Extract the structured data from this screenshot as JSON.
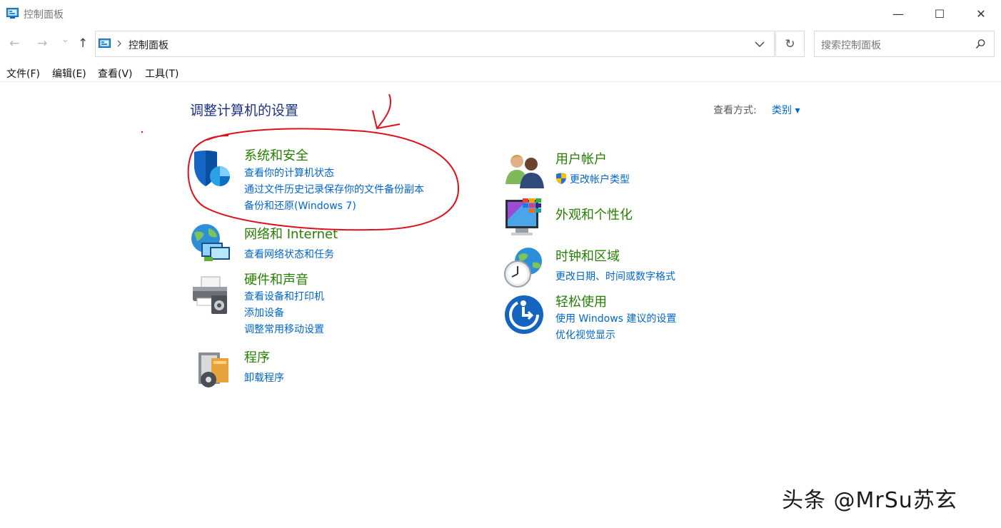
{
  "window": {
    "title": "控制面板",
    "minimize_label": "—",
    "maximize_label": "☐",
    "close_label": "✕"
  },
  "nav": {
    "back_label": "←",
    "forward_label": "→",
    "recent_label": "⌄",
    "up_label": "↑",
    "breadcrumb": "控制面板",
    "refresh_label": "↻",
    "search_placeholder": "搜索控制面板"
  },
  "menu": [
    "文件(F)",
    "编辑(E)",
    "查看(V)",
    "工具(T)"
  ],
  "main": {
    "heading": "调整计算机的设置",
    "view_by_label": "查看方式:",
    "view_by_value": "类别 ▾"
  },
  "categories_left": [
    {
      "title": "系统和安全",
      "links": [
        "查看你的计算机状态",
        "通过文件历史记录保存你的文件备份副本",
        "备份和还原(Windows 7)"
      ]
    },
    {
      "title": "网络和 Internet",
      "links": [
        "查看网络状态和任务"
      ]
    },
    {
      "title": "硬件和声音",
      "links": [
        "查看设备和打印机",
        "添加设备",
        "调整常用移动设置"
      ]
    },
    {
      "title": "程序",
      "links": [
        "卸载程序"
      ]
    }
  ],
  "categories_right": [
    {
      "title": "用户帐户",
      "links": [
        "更改帐户类型"
      ]
    },
    {
      "title": "外观和个性化",
      "links": []
    },
    {
      "title": "时钟和区域",
      "links": [
        "更改日期、时间或数字格式"
      ]
    },
    {
      "title": "轻松使用",
      "links": [
        "使用 Windows 建议的设置",
        "优化视觉显示"
      ]
    }
  ],
  "watermark": "头条 @MrSu苏玄",
  "colors": {
    "category_title": "#267f00",
    "link": "#0066cc",
    "heading": "#1e3287",
    "annotation": "#e0101a"
  }
}
